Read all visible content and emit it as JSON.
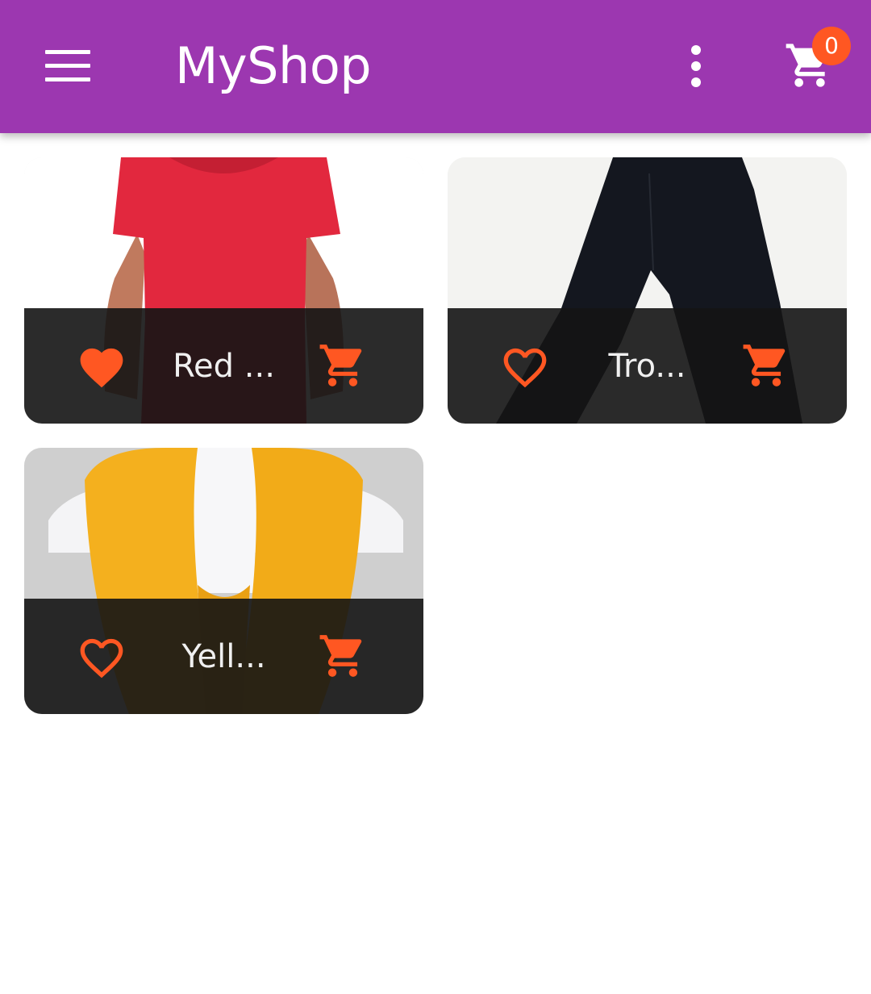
{
  "app": {
    "title": "MyShop",
    "cart_count": "0",
    "accent_color": "#9c37b0",
    "action_color": "#ff5722"
  },
  "icons": {
    "menu": "menu-icon",
    "more": "more-vert-icon",
    "cart": "shopping-cart-icon",
    "favorite": "heart-icon",
    "favorite_outline": "heart-outline-icon"
  },
  "products": [
    {
      "name": "Red ...",
      "favorite": true,
      "image": "red t-shirt"
    },
    {
      "name": "Tro...",
      "favorite": false,
      "image": "black trousers"
    },
    {
      "name": "Yell...",
      "favorite": false,
      "image": "yellow scarf"
    }
  ]
}
